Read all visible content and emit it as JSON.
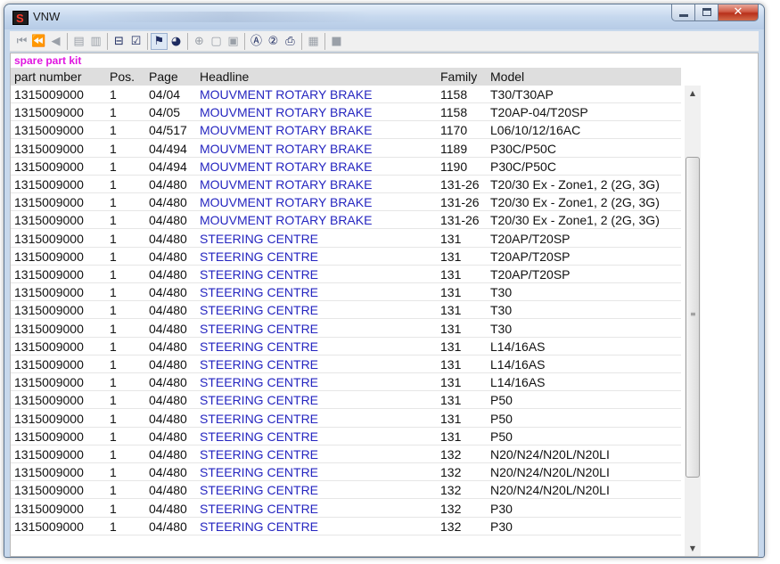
{
  "window": {
    "title": "VNW",
    "app_icon_glyph": "S",
    "minimize_glyph": "",
    "maximize_glyph": "",
    "close_glyph": "✕"
  },
  "toolbar": {
    "groups": [
      [
        {
          "name": "first-record-icon",
          "glyph": "⏮",
          "on": false
        },
        {
          "name": "previous-page-icon",
          "glyph": "⏪",
          "on": false
        },
        {
          "name": "previous-record-icon",
          "glyph": "◀",
          "on": false
        }
      ],
      [
        {
          "name": "export-icon",
          "glyph": "▤",
          "on": false
        },
        {
          "name": "import-icon",
          "glyph": "▥",
          "on": false
        }
      ],
      [
        {
          "name": "cart-icon",
          "glyph": "⊟",
          "on": true
        },
        {
          "name": "checklist-icon",
          "glyph": "☑",
          "on": true
        }
      ],
      [
        {
          "name": "filter-icon",
          "glyph": "⚑",
          "on": true,
          "selected": true
        },
        {
          "name": "chart-icon",
          "glyph": "◕",
          "on": true
        }
      ],
      [
        {
          "name": "zoom-icon",
          "glyph": "⊕",
          "on": false
        },
        {
          "name": "page-icon",
          "glyph": "▢",
          "on": false
        },
        {
          "name": "print-preview-icon",
          "glyph": "▣",
          "on": false
        }
      ],
      [
        {
          "name": "circle-a-icon",
          "glyph": "Ⓐ",
          "on": true
        },
        {
          "name": "circle-2-icon",
          "glyph": "②",
          "on": true
        },
        {
          "name": "printer-icon",
          "glyph": "⎙",
          "on": true
        }
      ],
      [
        {
          "name": "notes-icon",
          "glyph": "▦",
          "on": false
        }
      ],
      [
        {
          "name": "stop-icon",
          "glyph": "■",
          "on": false
        }
      ]
    ]
  },
  "list": {
    "subtitle": "spare part kit",
    "columns": {
      "part_number": "part number",
      "pos": "Pos.",
      "page": "Page",
      "headline": "Headline",
      "family": "Family",
      "model": "Model"
    },
    "rows": [
      [
        "1315009000",
        "1",
        "04/04",
        "MOUVMENT ROTARY BRAKE",
        "1158",
        "T30/T30AP"
      ],
      [
        "1315009000",
        "1",
        "04/05",
        "MOUVMENT ROTARY BRAKE",
        "1158",
        "T20AP-04/T20SP"
      ],
      [
        "1315009000",
        "1",
        "04/517",
        "MOUVMENT ROTARY BRAKE",
        "1170",
        "L06/10/12/16AC"
      ],
      [
        "1315009000",
        "1",
        "04/494",
        "MOUVMENT ROTARY BRAKE",
        "1189",
        "P30C/P50C"
      ],
      [
        "1315009000",
        "1",
        "04/494",
        "MOUVMENT ROTARY BRAKE",
        "1190",
        "P30C/P50C"
      ],
      [
        "1315009000",
        "1",
        "04/480",
        "MOUVMENT ROTARY BRAKE",
        "131-26",
        "T20/30 Ex - Zone1, 2 (2G, 3G)"
      ],
      [
        "1315009000",
        "1",
        "04/480",
        "MOUVMENT ROTARY BRAKE",
        "131-26",
        "T20/30 Ex - Zone1, 2 (2G, 3G)"
      ],
      [
        "1315009000",
        "1",
        "04/480",
        "MOUVMENT ROTARY BRAKE",
        "131-26",
        "T20/30 Ex - Zone1, 2 (2G, 3G)"
      ],
      [
        "1315009000",
        "1",
        "04/480",
        "STEERING CENTRE",
        "131",
        "T20AP/T20SP"
      ],
      [
        "1315009000",
        "1",
        "04/480",
        "STEERING CENTRE",
        "131",
        "T20AP/T20SP"
      ],
      [
        "1315009000",
        "1",
        "04/480",
        "STEERING CENTRE",
        "131",
        "T20AP/T20SP"
      ],
      [
        "1315009000",
        "1",
        "04/480",
        "STEERING CENTRE",
        "131",
        "T30"
      ],
      [
        "1315009000",
        "1",
        "04/480",
        "STEERING CENTRE",
        "131",
        "T30"
      ],
      [
        "1315009000",
        "1",
        "04/480",
        "STEERING CENTRE",
        "131",
        "T30"
      ],
      [
        "1315009000",
        "1",
        "04/480",
        "STEERING CENTRE",
        "131",
        "L14/16AS"
      ],
      [
        "1315009000",
        "1",
        "04/480",
        "STEERING CENTRE",
        "131",
        "L14/16AS"
      ],
      [
        "1315009000",
        "1",
        "04/480",
        "STEERING CENTRE",
        "131",
        "L14/16AS"
      ],
      [
        "1315009000",
        "1",
        "04/480",
        "STEERING CENTRE",
        "131",
        "P50"
      ],
      [
        "1315009000",
        "1",
        "04/480",
        "STEERING CENTRE",
        "131",
        "P50"
      ],
      [
        "1315009000",
        "1",
        "04/480",
        "STEERING CENTRE",
        "131",
        "P50"
      ],
      [
        "1315009000",
        "1",
        "04/480",
        "STEERING CENTRE",
        "132",
        "N20/N24/N20L/N20LI"
      ],
      [
        "1315009000",
        "1",
        "04/480",
        "STEERING CENTRE",
        "132",
        "N20/N24/N20L/N20LI"
      ],
      [
        "1315009000",
        "1",
        "04/480",
        "STEERING CENTRE",
        "132",
        "N20/N24/N20L/N20LI"
      ],
      [
        "1315009000",
        "1",
        "04/480",
        "STEERING CENTRE",
        "132",
        "P30"
      ],
      [
        "1315009000",
        "1",
        "04/480",
        "STEERING CENTRE",
        "132",
        "P30"
      ]
    ]
  },
  "scrollbar": {
    "up_glyph": "▲",
    "down_glyph": "▼",
    "grip_glyph": "≡"
  },
  "colors": {
    "subtitle": "#e016e0",
    "headline_text": "#2525c0",
    "header_background": "#dedede"
  }
}
